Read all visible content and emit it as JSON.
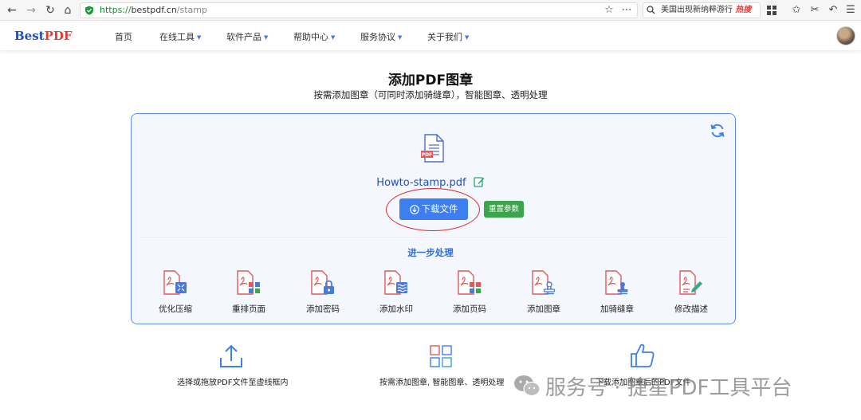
{
  "browser": {
    "url_scheme": "https://",
    "url_host": "bestpdf.cn",
    "url_path": "/stamp",
    "search_text": "美国出现新纳粹游行",
    "search_hot": "热搜"
  },
  "header": {
    "logo_best": "Best",
    "logo_pdf": "PDF",
    "menu": [
      {
        "label": "首页"
      },
      {
        "label": "在线工具"
      },
      {
        "label": "软件产品"
      },
      {
        "label": "帮助中心"
      },
      {
        "label": "服务协议"
      },
      {
        "label": "关于我们"
      }
    ]
  },
  "page": {
    "title": "添加PDF图章",
    "subtitle": "按需添加图章（可同时添加骑缝章），智能图章、透明处理"
  },
  "result": {
    "file_name": "Howto-stamp.pdf",
    "file_badge": "PDF",
    "download_label": "下载文件",
    "reset_label": "重置参数",
    "further_heading": "进一步处理"
  },
  "tools": [
    {
      "label": "优化压缩",
      "icon": "compress-icon"
    },
    {
      "label": "重排页面",
      "icon": "reorder-pages-icon"
    },
    {
      "label": "添加密码",
      "icon": "password-lock-icon"
    },
    {
      "label": "添加水印",
      "icon": "watermark-icon"
    },
    {
      "label": "添加页码",
      "icon": "page-number-icon"
    },
    {
      "label": "添加图章",
      "icon": "stamp-icon"
    },
    {
      "label": "加骑缝章",
      "icon": "seam-stamp-icon"
    },
    {
      "label": "修改描述",
      "icon": "edit-description-icon"
    }
  ],
  "features": [
    {
      "text": "选择或拖放PDF文件至虚线框内",
      "icon": "upload-icon"
    },
    {
      "text": "按需添加图章, 智能图章、透明处理",
      "icon": "grid-icon"
    },
    {
      "text": "下载添加图章后的PDF文件",
      "icon": "thumbs-up-icon"
    }
  ],
  "watermark": {
    "text": "服务号 · 捷星PDF工具平台"
  },
  "colors": {
    "primary": "#3d7ff0",
    "reset": "#3aa54a",
    "panel_border": "#5b8def",
    "icon_red": "#e05a5a",
    "highlight": "#d9282f"
  }
}
